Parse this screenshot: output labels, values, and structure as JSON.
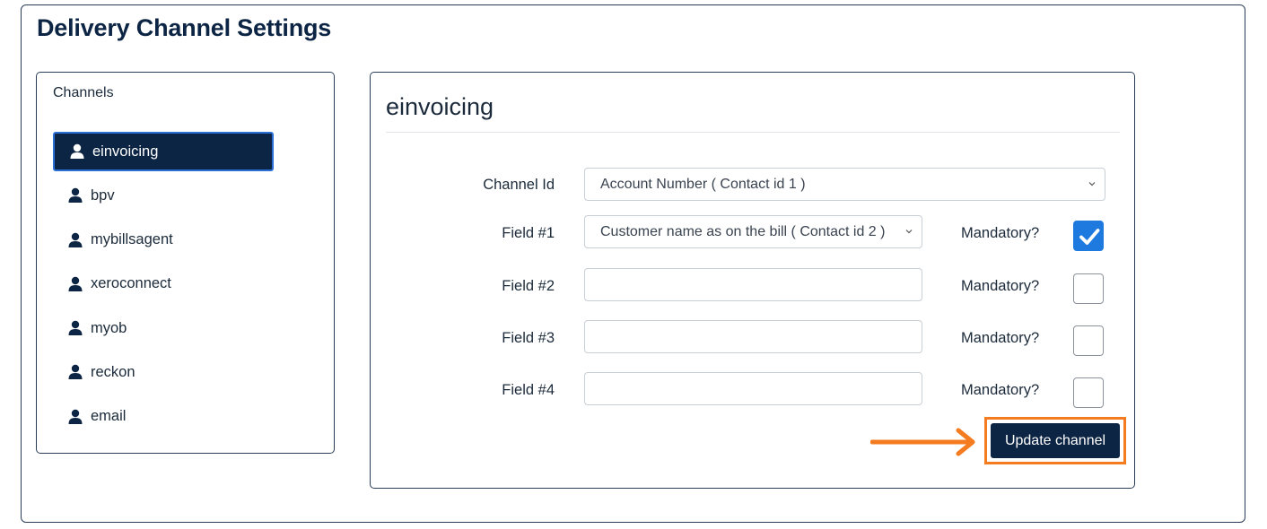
{
  "page": {
    "title": "Delivery Channel Settings"
  },
  "channels": {
    "heading": "Channels",
    "items": [
      {
        "label": "einvoicing",
        "icon": "user-icon",
        "active": true
      },
      {
        "label": "bpv",
        "icon": "user-icon",
        "active": false
      },
      {
        "label": "mybillsagent",
        "icon": "user-icon",
        "active": false
      },
      {
        "label": "xeroconnect",
        "icon": "user-icon",
        "active": false
      },
      {
        "label": "myob",
        "icon": "user-icon",
        "active": false
      },
      {
        "label": "reckon",
        "icon": "user-icon",
        "active": false
      },
      {
        "label": "email",
        "icon": "user-icon",
        "active": false
      }
    ]
  },
  "detail": {
    "title": "einvoicing",
    "channel_id": {
      "label": "Channel Id",
      "value": "Account Number ( Contact id 1 )"
    },
    "fields": [
      {
        "label": "Field #1",
        "value": "Customer name as on the bill ( Contact id 2 )",
        "type": "select",
        "mandatory": true
      },
      {
        "label": "Field #2",
        "value": "",
        "type": "text",
        "mandatory": false
      },
      {
        "label": "Field #3",
        "value": "",
        "type": "text",
        "mandatory": false
      },
      {
        "label": "Field #4",
        "value": "",
        "type": "text",
        "mandatory": false
      }
    ],
    "mandatory_label": "Mandatory?",
    "update_button": "Update channel"
  },
  "colors": {
    "navy": "#0d2544",
    "accent_blue": "#1f7ae0",
    "highlight_orange": "#f47b20"
  }
}
